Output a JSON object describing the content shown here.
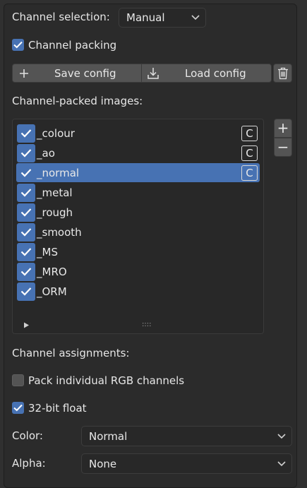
{
  "channel_selection": {
    "label": "Channel selection:",
    "value": "Manual"
  },
  "channel_packing": {
    "label": "Channel packing",
    "checked": true
  },
  "config": {
    "save_label": "Save config",
    "load_label": "Load config"
  },
  "packed_images": {
    "label": "Channel-packed images:",
    "items": [
      {
        "name": "_colour",
        "checked": true,
        "badge": "C",
        "selected": false
      },
      {
        "name": "_ao",
        "checked": true,
        "badge": "C",
        "selected": false
      },
      {
        "name": "_normal",
        "checked": true,
        "badge": "C",
        "selected": true
      },
      {
        "name": "_metal",
        "checked": true,
        "badge": "",
        "selected": false
      },
      {
        "name": "_rough",
        "checked": true,
        "badge": "",
        "selected": false
      },
      {
        "name": "_smooth",
        "checked": true,
        "badge": "",
        "selected": false
      },
      {
        "name": "_MS",
        "checked": true,
        "badge": "",
        "selected": false
      },
      {
        "name": "_MRO",
        "checked": true,
        "badge": "",
        "selected": false
      },
      {
        "name": "_ORM",
        "checked": true,
        "badge": "",
        "selected": false
      }
    ],
    "add_label": "+",
    "remove_label": "−",
    "grip_label": "::::"
  },
  "channel_assignments": {
    "label": "Channel assignments:"
  },
  "pack_rgb": {
    "label": "Pack individual RGB channels",
    "checked": false
  },
  "float32": {
    "label": "32-bit float",
    "checked": true
  },
  "color": {
    "label": "Color:",
    "value": "Normal"
  },
  "alpha": {
    "label": "Alpha:",
    "value": "None"
  },
  "colors": {
    "accent": "#4772b3",
    "panel": "#2b2b2b",
    "button": "#545454"
  }
}
